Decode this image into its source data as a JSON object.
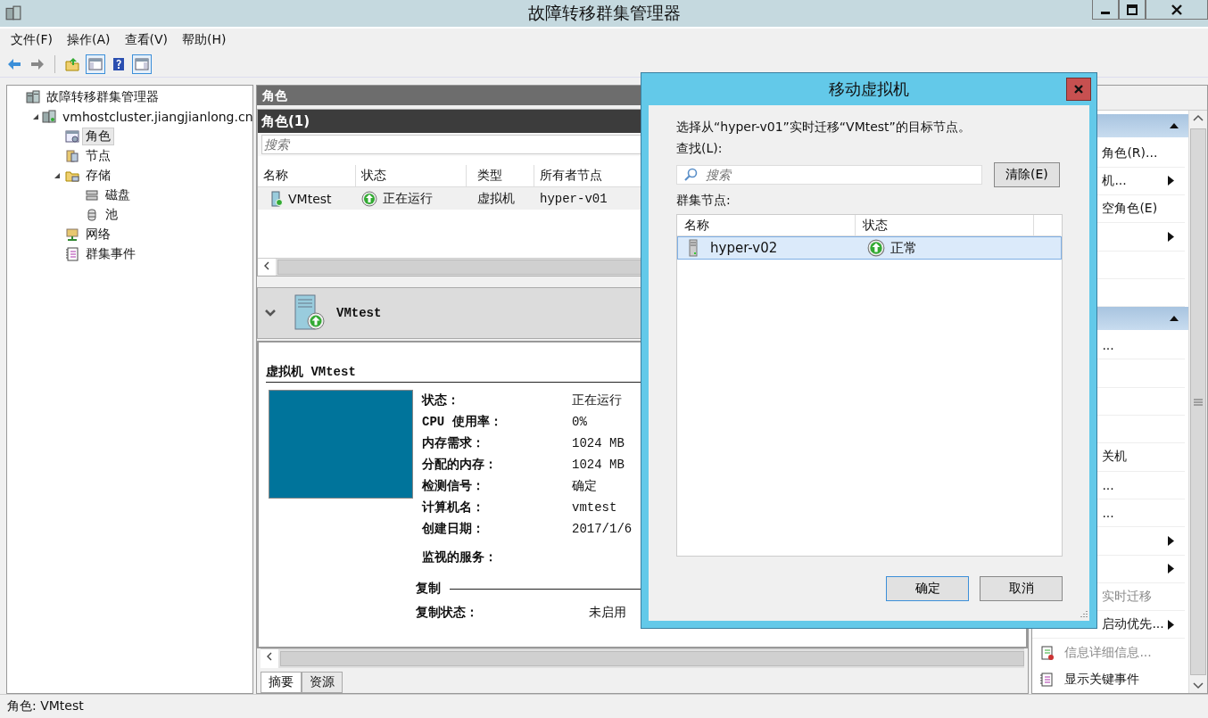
{
  "window": {
    "title": "故障转移群集管理器"
  },
  "menu": [
    "文件(F)",
    "操作(A)",
    "查看(V)",
    "帮助(H)"
  ],
  "toolbar": [
    {
      "kind": "back",
      "on": false
    },
    {
      "kind": "forward",
      "on": false
    },
    {
      "kind": "up",
      "on": false
    },
    {
      "kind": "tree-toggle",
      "on": true
    },
    {
      "kind": "help",
      "on": false
    },
    {
      "kind": "action-toggle",
      "on": true
    }
  ],
  "tree": [
    {
      "label": "故障转移群集管理器",
      "kind": "cluster-manager",
      "selected": false,
      "children": [
        {
          "label": "vmhostcluster.jiangjianlong.cn",
          "kind": "cluster",
          "selected": false,
          "expanded": true,
          "children": [
            {
              "label": "角色",
              "kind": "roles",
              "selected": true
            },
            {
              "label": "节点",
              "kind": "nodes",
              "selected": false
            },
            {
              "label": "存储",
              "kind": "storage",
              "selected": false,
              "expanded": true,
              "children": [
                {
                  "label": "磁盘",
                  "kind": "disks",
                  "selected": false
                },
                {
                  "label": "池",
                  "kind": "pool",
                  "selected": false
                }
              ]
            },
            {
              "label": "网络",
              "kind": "network",
              "selected": false
            },
            {
              "label": "群集事件",
              "kind": "events",
              "selected": false
            }
          ]
        }
      ]
    }
  ],
  "center": {
    "header": "角色",
    "list_title": "角色(1)",
    "search": {
      "placeholder": "搜索"
    },
    "columns": [
      "名称",
      "状态",
      "类型",
      "所有者节点"
    ],
    "rows": [
      {
        "cells": [
          "VMtest",
          "正在运行",
          "虚拟机",
          "hyper-v01"
        ],
        "selected": false
      }
    ]
  },
  "detail": {
    "name": "VMtest",
    "expanded": true,
    "heading": "虚拟机 VMtest",
    "properties": [
      {
        "label": "状态：",
        "value": "正在运行"
      },
      {
        "label": "CPU 使用率：",
        "value": "0%"
      },
      {
        "label": "内存需求：",
        "value": "1024 MB"
      },
      {
        "label": "分配的内存：",
        "value": "1024 MB"
      },
      {
        "label": "检测信号：",
        "value": "确定"
      },
      {
        "label": "计算机名：",
        "value": "vmtest"
      },
      {
        "label": "创建日期：",
        "value": "2017/1/6"
      }
    ],
    "monitored_label": "监视的服务：",
    "replication": {
      "title": "复制",
      "label": "复制状态：",
      "value": "未启用"
    },
    "tabs": [
      {
        "label": "摘要",
        "selected": true
      },
      {
        "label": "资源",
        "selected": false
      }
    ]
  },
  "actions": [
    {
      "kind": "header",
      "expanded": true
    },
    {
      "kind": "cut",
      "label": "角色(R)...",
      "submenu": false,
      "disabled": false
    },
    {
      "kind": "cut",
      "label": "机...",
      "submenu": true,
      "disabled": false
    },
    {
      "kind": "cut",
      "label": "空角色(E)",
      "submenu": false,
      "disabled": false
    },
    {
      "kind": "cut",
      "submenu": true
    },
    {
      "kind": "cut",
      "submenu": false
    },
    {
      "kind": "cut",
      "submenu": false
    },
    {
      "kind": "header",
      "expanded": true
    },
    {
      "kind": "cut",
      "label": "...",
      "submenu": false,
      "disabled": false
    },
    {
      "kind": "cut",
      "submenu": false
    },
    {
      "kind": "cut",
      "submenu": false
    },
    {
      "kind": "cut",
      "submenu": false
    },
    {
      "kind": "cut",
      "label": "关机",
      "submenu": false,
      "disabled": false
    },
    {
      "kind": "cut",
      "label": "...",
      "submenu": false,
      "disabled": false
    },
    {
      "kind": "cut",
      "label": "...",
      "submenu": false,
      "disabled": false
    },
    {
      "kind": "cut",
      "submenu": true
    },
    {
      "kind": "cut",
      "submenu": true
    },
    {
      "kind": "cut",
      "label": "实时迁移",
      "submenu": false,
      "disabled": true
    },
    {
      "kind": "cut",
      "label": "启动优先...",
      "submenu": true,
      "disabled": false
    },
    {
      "kind": "details",
      "label": "信息详细信息...",
      "submenu": false,
      "disabled": true
    },
    {
      "kind": "events",
      "label": "显示关键事件",
      "submenu": false,
      "disabled": false
    }
  ],
  "dialog": {
    "title": "移动虚拟机",
    "instruction": "选择从“hyper-v01”实时迁移“VMtest”的目标节点。",
    "find_label": "查找(L):",
    "search": {
      "placeholder": "搜索"
    },
    "clear_button": "清除(E)",
    "nodes_label": "群集节点:",
    "columns": [
      "名称",
      "状态"
    ],
    "rows": [
      {
        "cells": [
          "hyper-v02",
          "正常"
        ],
        "selected": true
      }
    ],
    "buttons": [
      {
        "label": "确定",
        "default": true
      },
      {
        "label": "取消",
        "default": false
      }
    ]
  },
  "status_bar": "角色: VMtest"
}
